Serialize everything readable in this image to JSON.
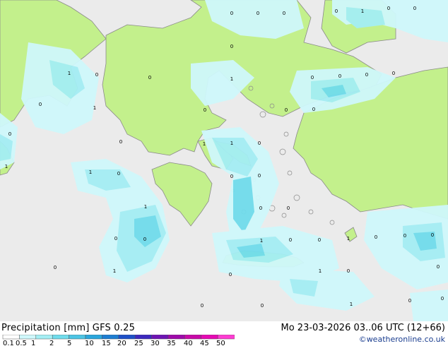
{
  "title": "Precipitation [mm]  GFS 0.25",
  "datetime": "Mo 23-03-2026 03..06 UTC (12+66)",
  "credit": "©weatheronline.co.uk",
  "colors": {
    "sea": "#ebebeb",
    "land": "#c3f08c",
    "coast": "#8a8a8a",
    "precip_light": "#cff8fb",
    "precip_medium": "#a4eef4",
    "precip_heavy": "#70dcec",
    "precip_core": "#4cc4e4"
  },
  "legend": {
    "labels": [
      "0.1",
      "0.5",
      "1",
      "2",
      "5",
      "10",
      "15",
      "20",
      "25",
      "30",
      "35",
      "40",
      "45",
      "50"
    ],
    "colors": [
      "#ffffff",
      "#cff8fb",
      "#a4eef4",
      "#70dcec",
      "#4cc4e4",
      "#2aa6dc",
      "#1e7ed2",
      "#1e50c8",
      "#3c28be",
      "#6e14b4",
      "#9e0aaa",
      "#c80aa8",
      "#e60ab4",
      "#ff3cd2"
    ]
  },
  "map_values": [
    {
      "label": "0"
    },
    {
      "label": "0"
    },
    {
      "label": "0"
    },
    {
      "label": "0"
    },
    {
      "label": "1"
    },
    {
      "label": "0"
    },
    {
      "label": "0"
    },
    {
      "label": "0"
    },
    {
      "label": "1"
    },
    {
      "label": "0"
    },
    {
      "label": "0"
    },
    {
      "label": "1"
    },
    {
      "label": "0"
    },
    {
      "label": "0"
    },
    {
      "label": "0"
    },
    {
      "label": "0"
    },
    {
      "label": "0"
    },
    {
      "label": "1"
    },
    {
      "label": "0"
    },
    {
      "label": "0"
    },
    {
      "label": "0"
    },
    {
      "label": "0"
    },
    {
      "label": "0"
    },
    {
      "label": "1"
    },
    {
      "label": "1"
    },
    {
      "label": "0"
    },
    {
      "label": "1"
    },
    {
      "label": "1"
    },
    {
      "label": "0"
    },
    {
      "label": "0"
    },
    {
      "label": "0"
    },
    {
      "label": "1"
    },
    {
      "label": "0"
    },
    {
      "label": "0"
    },
    {
      "label": "0"
    },
    {
      "label": "0"
    },
    {
      "label": "1"
    },
    {
      "label": "0"
    },
    {
      "label": "0"
    },
    {
      "label": "1"
    },
    {
      "label": "0"
    },
    {
      "label": "0"
    },
    {
      "label": "0"
    },
    {
      "label": "0"
    },
    {
      "label": "1"
    },
    {
      "label": "0"
    },
    {
      "label": "1"
    },
    {
      "label": "0"
    },
    {
      "label": "0"
    },
    {
      "label": "0"
    },
    {
      "label": "1"
    },
    {
      "label": "0"
    },
    {
      "label": "0"
    },
    {
      "label": "0"
    }
  ]
}
